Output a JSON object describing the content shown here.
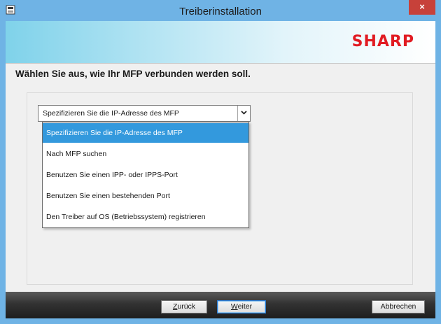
{
  "window": {
    "title": "Treiberinstallation",
    "close_label": "×"
  },
  "banner": {
    "logo_text": "SHARP"
  },
  "main": {
    "heading": "Wählen Sie aus, wie Ihr MFP verbunden werden soll."
  },
  "connection_select": {
    "selected_value": "Spezifizieren Sie die IP-Adresse des MFP",
    "options": [
      "Spezifizieren Sie die IP-Adresse des MFP",
      "Nach MFP suchen",
      "Benutzen Sie einen IPP- oder IPPS-Port",
      "Benutzen Sie einen bestehenden Port",
      "Den Treiber auf OS (Betriebssystem) registrieren"
    ],
    "highlighted_index": 0
  },
  "footer": {
    "back": {
      "mnemonic": "Z",
      "rest": "urück"
    },
    "next": {
      "mnemonic": "W",
      "rest": "eiter"
    },
    "cancel": "Abbrechen"
  },
  "colors": {
    "titlebar": "#6fb3e5",
    "close_button": "#c7413a",
    "logo": "#e11b22",
    "selection": "#3399dd"
  }
}
